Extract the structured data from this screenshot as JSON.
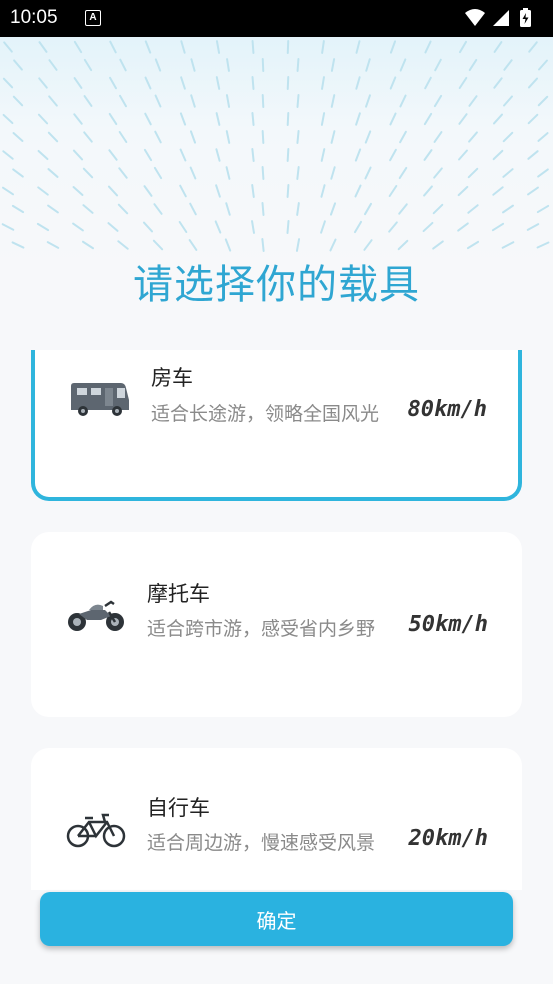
{
  "status": {
    "time": "10:05",
    "notification_icon": "A"
  },
  "title": "请选择你的载具",
  "vehicles": [
    {
      "name": "房车",
      "desc": "适合长途游，领略全国风光",
      "speed": "80km/h",
      "icon": "rv-icon",
      "selected": true
    },
    {
      "name": "摩托车",
      "desc": "适合跨市游，感受省内乡野",
      "speed": "50km/h",
      "icon": "motorcycle-icon",
      "selected": false
    },
    {
      "name": "自行车",
      "desc": "适合周边游，慢速感受风景",
      "speed": "20km/h",
      "icon": "bicycle-icon",
      "selected": false
    }
  ],
  "confirm_label": "确定",
  "colors": {
    "accent": "#2ab2e0",
    "title": "#2fa6d2",
    "selected_border": "#2fb5dd"
  }
}
